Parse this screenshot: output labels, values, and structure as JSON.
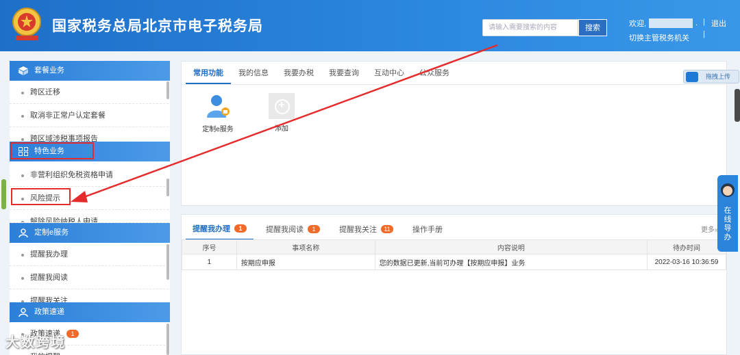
{
  "header": {
    "site_title": "国家税务总局北京市电子税务局",
    "search_placeholder": "请输入需要搜索的内容",
    "search_button": "搜索",
    "welcome": "欢迎,",
    "welcome_tail": ".",
    "separator": "|",
    "logout": "退出",
    "switch_org": "切换主管税务机关"
  },
  "sidebar": {
    "sections": [
      {
        "title": "套餐业务",
        "icon": "cube-icon",
        "items": [
          "跨区迁移",
          "取消非正常户认定套餐",
          "跨区域涉税事项报告"
        ]
      },
      {
        "title": "特色业务",
        "icon": "grid-icon",
        "items": [
          "非营利组织免税资格申请",
          "风险提示",
          "解除风险纳税人申请"
        ]
      },
      {
        "title": "定制e服务",
        "icon": "user-icon",
        "items": [
          "提醒我办理",
          "提醒我阅读",
          "提醒我关注"
        ]
      },
      {
        "title": "政策速递",
        "icon": "user-icon",
        "items": [
          "政策速递",
          "我的提醒"
        ]
      }
    ],
    "policy_badge": "1"
  },
  "top_panel": {
    "tabs": [
      "常用功能",
      "我的信息",
      "我要办税",
      "我要查询",
      "互动中心",
      "公众服务"
    ],
    "active_tab": 0,
    "functions": [
      {
        "label": "定制e服务",
        "icon": "custom-service-icon"
      },
      {
        "label": "添加",
        "icon": "add-icon"
      }
    ]
  },
  "bottom_panel": {
    "tabs": [
      {
        "label": "提醒我办理",
        "badge": "1"
      },
      {
        "label": "提醒我阅读",
        "badge": "1"
      },
      {
        "label": "提醒我关注",
        "badge": "11"
      },
      {
        "label": "操作手册",
        "badge": ""
      }
    ],
    "more": "更多»",
    "columns": [
      "序号",
      "事项名称",
      "内容说明",
      "待办时间"
    ],
    "rows": [
      [
        "1",
        "按期应申报",
        "您的数据已更新,当前可办理【按期应申报】业务",
        "2022-03-16 10:36:59"
      ]
    ]
  },
  "floating": {
    "drag_upload": "拖拽上传",
    "online_service": "在线导办"
  },
  "watermark": "大数跨境",
  "colors": {
    "header_blue": "#2b86de",
    "accent_blue": "#1f6fc4",
    "badge_orange": "#f06b2a",
    "annotation_red": "#e52b2b"
  }
}
